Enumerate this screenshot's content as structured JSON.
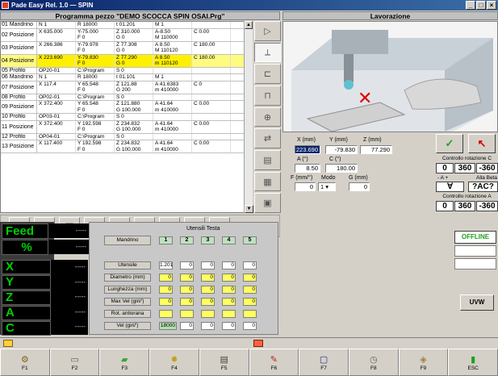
{
  "window": {
    "title": "Pade Easy Rel. 1.0 — SPIN",
    "controls": [
      "_",
      "□",
      "×"
    ]
  },
  "program_panel": {
    "title": "Programma pezzo \"DEMO SCOCCA SPIN OSAI.Prg\"",
    "rows": [
      {
        "label": "01 Mandrino",
        "lines": [
          [
            "N 1",
            "R 18000",
            "t 01.201",
            "M 1",
            ""
          ]
        ]
      },
      {
        "label": "02 Posizione",
        "lines": [
          [
            "X 635.000",
            "Y-75.000",
            "Z 310.000",
            "A-8.50",
            "C 0.00"
          ],
          [
            "",
            "F 0",
            "G 0",
            "M 110000",
            ""
          ]
        ]
      },
      {
        "label": "03 Posizione",
        "lines": [
          [
            "X 266.386",
            "Y-79.978",
            "Z 77.308",
            "A 8.50",
            "C 180.00"
          ],
          [
            "",
            "F 0",
            "G 0",
            "M 110120",
            ""
          ]
        ]
      },
      {
        "label": "04 Posizione",
        "highlight": true,
        "lines": [
          [
            "X 223.690",
            "Y-79.830",
            "Z 77.290",
            "A 8.50",
            "C 180.00"
          ],
          [
            "",
            "F 0",
            "G 0",
            "m 110120",
            ""
          ]
        ]
      },
      {
        "label": "05 Profilo",
        "lines": [
          [
            "OP20-01",
            "C:\\Program",
            "S 0",
            "",
            ""
          ]
        ]
      },
      {
        "label": "06 Mandrino",
        "lines": [
          [
            "N 1",
            "R 18000",
            "t 01.101",
            "M 1",
            ""
          ]
        ]
      },
      {
        "label": "07 Posizione",
        "lines": [
          [
            "X 117.4",
            "Y 65.548",
            "Z 121.88",
            "A 41.6383",
            "C 0"
          ],
          [
            "",
            "F 0",
            "G 200",
            "m 410000",
            ""
          ]
        ]
      },
      {
        "label": "08 Profilo",
        "lines": [
          [
            "OP02-01",
            "C:\\Program",
            "S 0",
            "",
            ""
          ]
        ]
      },
      {
        "label": "09 Posizione",
        "lines": [
          [
            "X 372.400",
            "Y 65.548",
            "Z 121.880",
            "A 41.64",
            "C 0.00"
          ],
          [
            "",
            "F 0",
            "G 100.000",
            "m 410000",
            ""
          ]
        ]
      },
      {
        "label": "10 Profilo",
        "lines": [
          [
            "OP03-01",
            "C:\\Program",
            "S 0",
            "",
            ""
          ]
        ]
      },
      {
        "label": "11 Posizione",
        "lines": [
          [
            "X 372.400",
            "Y 192.598",
            "Z 234.832",
            "A 41.64",
            "C 0.00"
          ],
          [
            "",
            "F 0",
            "G 100.000",
            "m 410000",
            ""
          ]
        ]
      },
      {
        "label": "12 Profilo",
        "lines": [
          [
            "OP04-01",
            "C:\\Program",
            "S 0",
            "",
            ""
          ]
        ]
      },
      {
        "label": "13 Posizione",
        "lines": [
          [
            "X 117.400",
            "Y 192.598",
            "Z 234.832",
            "A 41.64",
            "C 0.00"
          ],
          [
            "",
            "F 0",
            "G 100.000",
            "m 410000",
            ""
          ]
        ]
      }
    ],
    "toolbar_icons": [
      "new-file-icon",
      "open-folder-icon",
      "save-icon",
      "add-icon",
      "refresh-icon",
      "cut-icon",
      "copy-icon",
      "paste-icon",
      "play-icon"
    ]
  },
  "lavorazione": {
    "title": "Lavorazione",
    "coords": {
      "x_label": "X (mm)",
      "y_label": "Y (mm)",
      "z_label": "Z (mm)",
      "x_val": "223.690",
      "y_val": "-79.830",
      "z_val": "77.290",
      "a_label": "A (°)",
      "c_label": "C (°)",
      "a_val": "8.50",
      "c_val": "180.00",
      "f_label": "F (mm/°)",
      "mode_label": "Modo",
      "g_label": "G (mm)",
      "f_val": "0",
      "mode_val": "1",
      "g_val": "0"
    },
    "controls": {
      "ok": "✓",
      "cancel": "↖",
      "rot_c_label": "Controllo rotazione C",
      "rot_c_vals": [
        "0",
        "360",
        "-360"
      ],
      "a_plus_label": "- A +",
      "alla_beta_label": "Alla Beta",
      "forall": "∀",
      "beta_q": "?AC?",
      "rot_a_label": "Controllo rotazione A",
      "rot_a_vals": [
        "0",
        "360",
        "-360"
      ]
    }
  },
  "status": {
    "feed_label": "Feed",
    "percent_label": "%",
    "dashes": "-----",
    "axes": [
      "X",
      "Y",
      "Z",
      "A",
      "C"
    ]
  },
  "tool_grid": {
    "title": "Utensili Testa",
    "mandrino_label": "Mandrino",
    "columns": [
      "1",
      "2",
      "3",
      "4",
      "5"
    ],
    "rows": [
      {
        "label": "Utensile",
        "values": [
          "1.201",
          "0",
          "0",
          "0",
          "0"
        ],
        "style": "w"
      },
      {
        "label": "Diametro (mm)",
        "values": [
          "0",
          "0",
          "0",
          "0",
          "0"
        ],
        "style": "y"
      },
      {
        "label": "Lunghezza (mm)",
        "values": [
          "0",
          "0",
          "0",
          "0",
          "0"
        ],
        "style": "y"
      },
      {
        "label": "Max Vel (giri/')",
        "values": [
          "0",
          "0",
          "0",
          "0",
          "0"
        ],
        "style": "y"
      },
      {
        "label": "Rot. antiorana",
        "values": [
          "",
          "",
          "",
          "",
          ""
        ],
        "style": "y"
      },
      {
        "label": "Vel (giri/')",
        "values": [
          "18000",
          "0",
          "0",
          "0",
          "0"
        ],
        "style": "g"
      }
    ]
  },
  "right_status": {
    "offline": "OFFLINE",
    "uvw": "UVW"
  },
  "function_keys": [
    {
      "label": "F1",
      "icon": "tool-icon"
    },
    {
      "label": "F2",
      "icon": "ruler-icon"
    },
    {
      "label": "F3",
      "icon": "folder-icon"
    },
    {
      "label": "F4",
      "icon": "gear-icon"
    },
    {
      "label": "F5",
      "icon": "document-icon"
    },
    {
      "label": "F6",
      "icon": "pencil-icon"
    },
    {
      "label": "F7",
      "icon": "iso-icon"
    },
    {
      "label": "F8",
      "icon": "clock-icon"
    },
    {
      "label": "F9",
      "icon": "cube-icon"
    },
    {
      "label": "ESC",
      "icon": "exit-icon"
    }
  ]
}
